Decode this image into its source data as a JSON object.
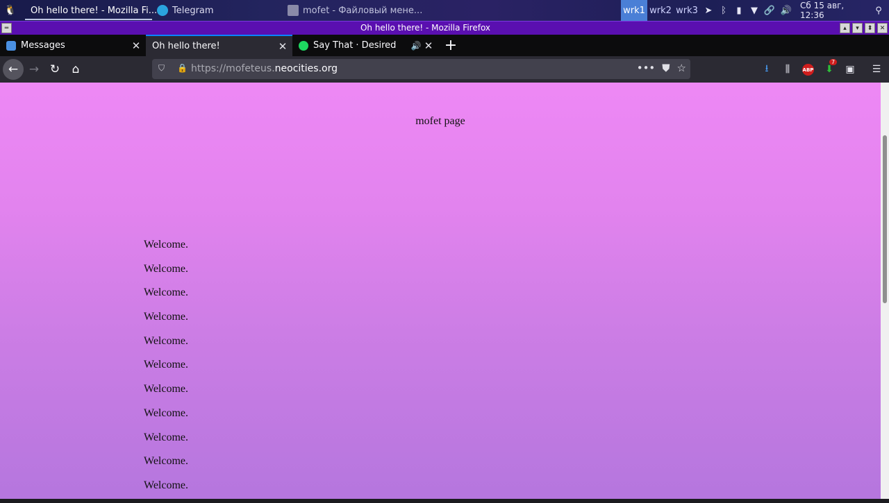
{
  "taskbar": {
    "apps": [
      {
        "label": "Oh hello there! - Mozilla Fi...",
        "icon": "firefox-icon"
      },
      {
        "label": "Telegram",
        "icon": "telegram-icon"
      },
      {
        "label": "mofet - Файловый мене...",
        "icon": "home-folder-icon"
      }
    ],
    "workspaces": [
      "wrk1",
      "wrk2",
      "wrk3"
    ],
    "active_workspace": "wrk1",
    "clock": "Сб 15 авг, 12:36"
  },
  "window": {
    "title": "Oh hello there! - Mozilla Firefox"
  },
  "tabs": [
    {
      "label": "Messages",
      "favicon": "messages-icon",
      "selected": false
    },
    {
      "label": "Oh hello there!",
      "favicon": "",
      "selected": true
    },
    {
      "label": "Say That · Desired",
      "favicon": "spotify-icon",
      "selected": false,
      "playing_audio": true
    }
  ],
  "navbar": {
    "url_prefix": "https://mofeteus.",
    "url_host": "neocities.org",
    "downloads_badge": "7"
  },
  "page": {
    "title": "mofet page",
    "welcome": [
      "Welcome.",
      "Welcome.",
      "Welcome.",
      "Welcome.",
      "Welcome.",
      "Welcome.",
      "Welcome.",
      "Welcome.",
      "Welcome.",
      "Welcome.",
      "Welcome."
    ]
  },
  "colors": {
    "titlebar": "#5a0fb0",
    "tab_accent": "#0a84ff",
    "content_top": "#ee88f5",
    "content_bottom": "#b576de"
  }
}
